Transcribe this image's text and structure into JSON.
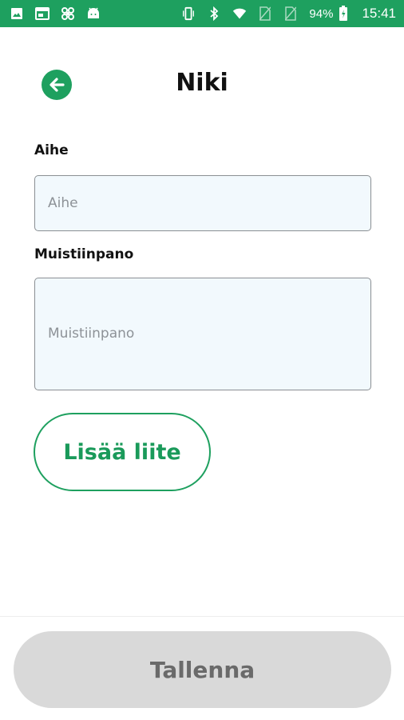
{
  "status_bar": {
    "battery_percent": "94%",
    "time": "15:41",
    "left_icons": [
      "image-icon",
      "window-icon",
      "fan-icon",
      "android-icon"
    ],
    "right_icons": [
      "vibrate-icon",
      "bluetooth-icon",
      "wifi-icon",
      "no-sim-icon",
      "no-sim-icon",
      "battery-icon"
    ],
    "color": "#1ea05f"
  },
  "header": {
    "title": "Niki",
    "back_icon": "arrow-left-icon"
  },
  "form": {
    "subject": {
      "label": "Aihe",
      "placeholder": "Aihe",
      "value": ""
    },
    "note": {
      "label": "Muistiinpano",
      "placeholder": "Muistiinpano",
      "value": ""
    },
    "attach_label": "Lisää liite"
  },
  "footer": {
    "save_label": "Tallenna",
    "save_enabled": false
  },
  "colors": {
    "accent": "#1ea05f",
    "input_bg": "#f2f9fd",
    "disabled_bg": "#d9d9d9"
  }
}
